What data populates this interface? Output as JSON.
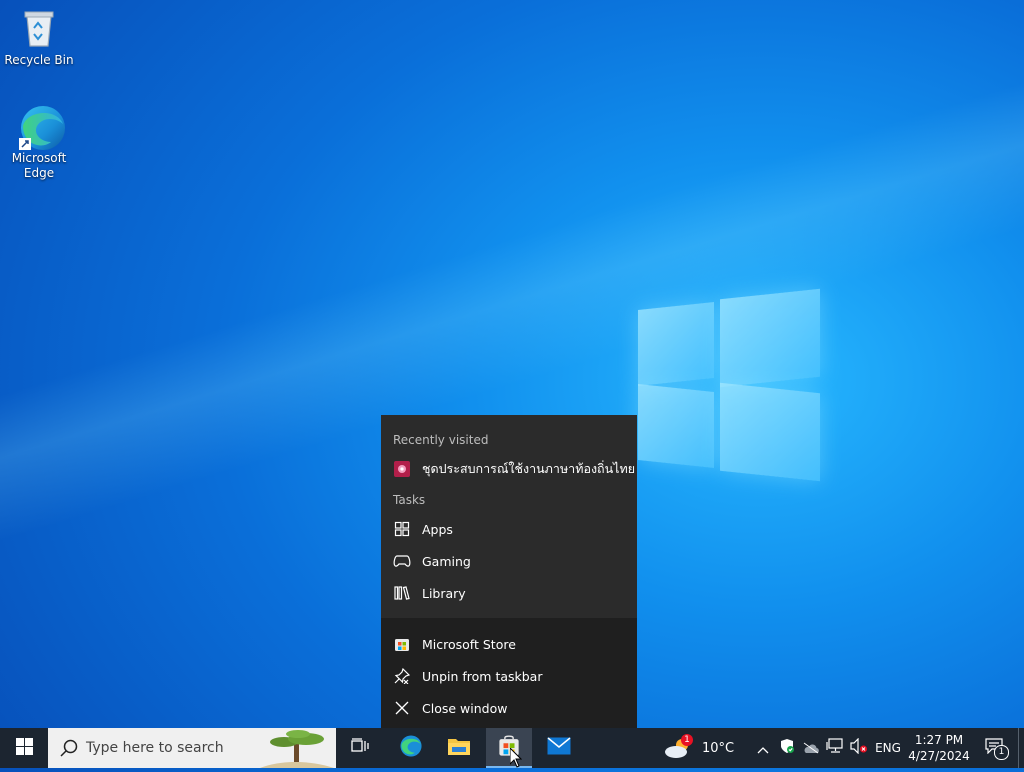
{
  "desktop": {
    "icons": [
      {
        "label": "Recycle Bin"
      },
      {
        "label": "Microsoft\nEdge"
      }
    ]
  },
  "context_menu": {
    "recent_header": "Recently visited",
    "recent_item": "ชุดประสบการณ์ใช้งานภาษาท้องถิ่นไทย",
    "tasks_header": "Tasks",
    "tasks": [
      "Apps",
      "Gaming",
      "Library"
    ],
    "actions": [
      "Microsoft Store",
      "Unpin from taskbar",
      "Close window"
    ]
  },
  "taskbar": {
    "search_placeholder": "Type here to search",
    "weather": {
      "temp": "10°C",
      "badge": "1"
    },
    "language": "ENG",
    "time": "1:27 PM",
    "date": "4/27/2024",
    "notification_count": "1"
  },
  "colors": {
    "accent": "#0a6fd9",
    "taskbar": "#1c2530",
    "menu": "#2b2b2b"
  }
}
